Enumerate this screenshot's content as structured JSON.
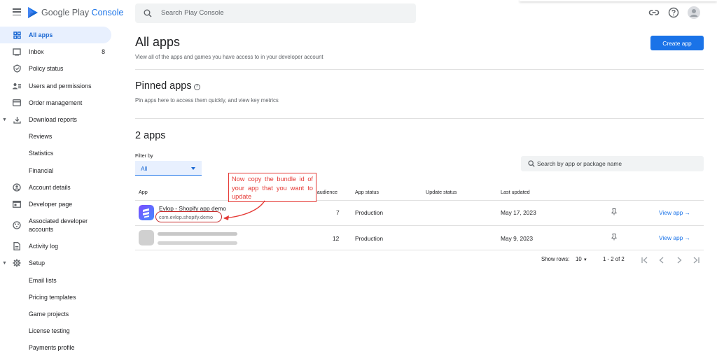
{
  "brand": {
    "word1": "Google Play",
    "word2": " Console"
  },
  "search": {
    "placeholder": "Search Play Console"
  },
  "sidebar": {
    "items": [
      {
        "label": "All apps",
        "icon": "grid-icon",
        "active": true
      },
      {
        "label": "Inbox",
        "icon": "inbox-icon",
        "count": "8"
      },
      {
        "label": "Policy status",
        "icon": "shield-icon"
      },
      {
        "label": "Users and permissions",
        "icon": "users-icon"
      },
      {
        "label": "Order management",
        "icon": "card-icon"
      },
      {
        "label": "Download reports",
        "icon": "download-icon"
      },
      {
        "label": "Reviews"
      },
      {
        "label": "Statistics"
      },
      {
        "label": "Financial"
      },
      {
        "label": "Account details",
        "icon": "account-icon"
      },
      {
        "label": "Developer page",
        "icon": "page-icon"
      },
      {
        "label": "Associated developer accounts",
        "icon": "associated-icon"
      },
      {
        "label": "Activity log",
        "icon": "log-icon"
      },
      {
        "label": "Setup",
        "icon": "gear-icon"
      },
      {
        "label": "Email lists"
      },
      {
        "label": "Pricing templates"
      },
      {
        "label": "Game projects"
      },
      {
        "label": "License testing"
      },
      {
        "label": "Payments profile"
      }
    ]
  },
  "main": {
    "title": "All apps",
    "subtitle": "View all of the apps and games you have access to in your developer account",
    "create_button": "Create app",
    "pinned": {
      "title": "Pinned apps",
      "subtitle": "Pin apps here to access them quickly, and view key metrics"
    },
    "apps_count_title": "2 apps",
    "filter": {
      "label": "Filter by",
      "value": "All"
    },
    "app_search": {
      "placeholder": "Search by app or package name"
    },
    "table": {
      "headers": [
        "App",
        "Installed audience",
        "App status",
        "Update status",
        "Last updated"
      ],
      "rows": [
        {
          "name": "Evlop - Shopify app demo",
          "package": "com.evlop.shopify.demo",
          "installs": "7",
          "status": "Production",
          "updated": "May 17, 2023",
          "action": "View app"
        },
        {
          "name": "",
          "package": "",
          "installs": "12",
          "status": "Production",
          "updated": "May 9, 2023",
          "action": "View app"
        }
      ]
    },
    "pager": {
      "rows_label": "Show rows:",
      "rows_value": "10",
      "range": "1 - 2 of 2"
    }
  },
  "annotation": {
    "text": "Now copy the bundle id of your app that you want to update",
    "color": "#e53935"
  },
  "colors": {
    "accent": "#1a73e8",
    "active_bg": "#e8f0fe",
    "annotation": "#e53935"
  }
}
